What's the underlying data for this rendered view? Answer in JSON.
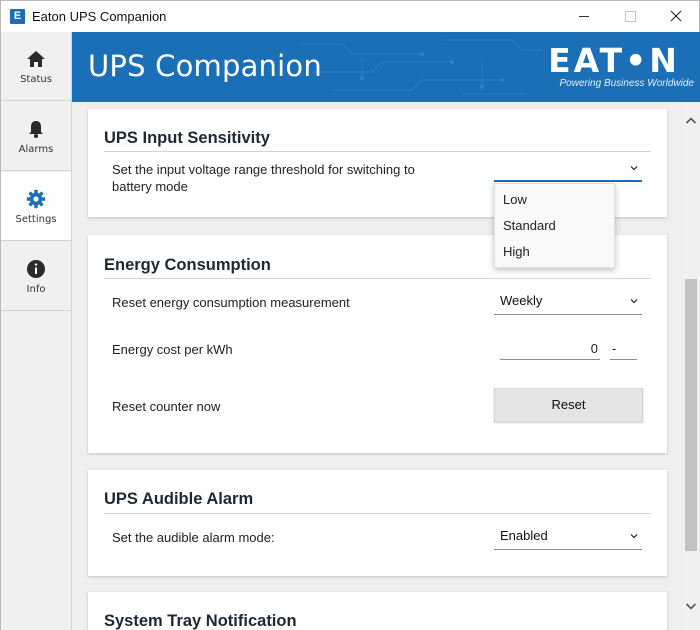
{
  "window": {
    "title": "Eaton UPS Companion",
    "icon_letter": "E"
  },
  "sidebar": {
    "items": [
      {
        "label": "Status",
        "icon": "home-icon"
      },
      {
        "label": "Alarms",
        "icon": "bell-icon"
      },
      {
        "label": "Settings",
        "icon": "gear-icon"
      },
      {
        "label": "Info",
        "icon": "info-icon"
      }
    ],
    "active": "Settings"
  },
  "header": {
    "title": "UPS Companion",
    "brand": "EAT•N",
    "tagline": "Powering Business Worldwide",
    "color": "#1b6fb6"
  },
  "sensitivity": {
    "title": "UPS Input Sensitivity",
    "label": "Set the input voltage range threshold for switching to battery mode",
    "value": "",
    "options": [
      "Low",
      "Standard",
      "High"
    ]
  },
  "energy": {
    "title": "Energy Consumption",
    "reset_label": "Reset energy consumption measurement",
    "reset_value": "Weekly",
    "cost_label": "Energy cost per kWh",
    "cost_value": "0",
    "currency_value": "-",
    "counter_label": "Reset counter now",
    "reset_button": "Reset"
  },
  "alarm": {
    "title": "UPS Audible Alarm",
    "label": "Set the audible alarm mode:",
    "value": "Enabled"
  },
  "tray": {
    "title": "System Tray Notification"
  }
}
